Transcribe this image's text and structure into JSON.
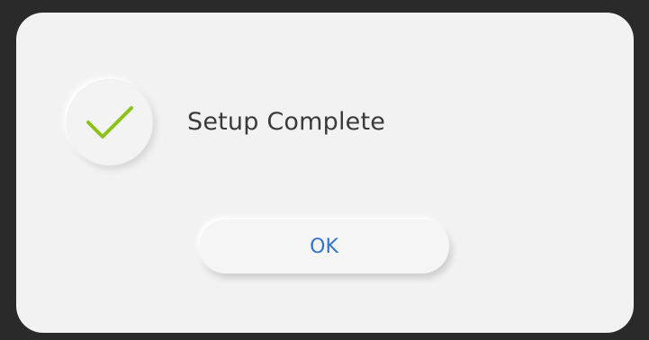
{
  "dialog": {
    "title": "Setup Complete",
    "ok_label": "OK",
    "icon": "checkmark-icon"
  },
  "colors": {
    "check": "#8cc21a",
    "ok_text": "#2f74d0",
    "dialog_bg": "#f2f2f2",
    "title_text": "#3a3a3a"
  }
}
